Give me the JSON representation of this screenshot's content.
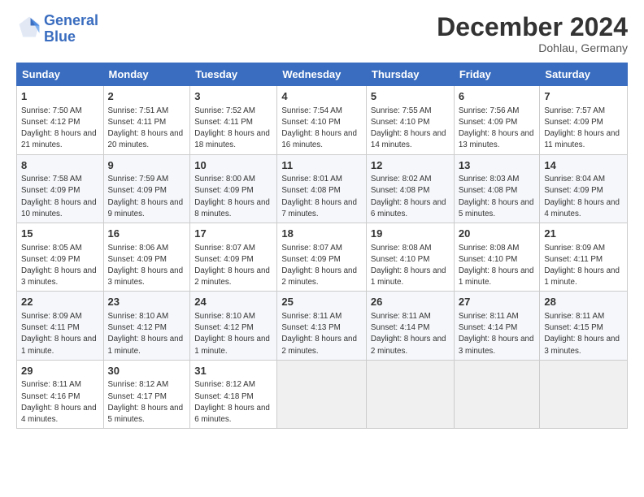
{
  "logo": {
    "line1": "General",
    "line2": "Blue"
  },
  "title": "December 2024",
  "location": "Dohlau, Germany",
  "columns": [
    "Sunday",
    "Monday",
    "Tuesday",
    "Wednesday",
    "Thursday",
    "Friday",
    "Saturday"
  ],
  "weeks": [
    [
      {
        "day": "1",
        "sunrise": "7:50 AM",
        "sunset": "4:12 PM",
        "daylight": "8 hours and 21 minutes."
      },
      {
        "day": "2",
        "sunrise": "7:51 AM",
        "sunset": "4:11 PM",
        "daylight": "8 hours and 20 minutes."
      },
      {
        "day": "3",
        "sunrise": "7:52 AM",
        "sunset": "4:11 PM",
        "daylight": "8 hours and 18 minutes."
      },
      {
        "day": "4",
        "sunrise": "7:54 AM",
        "sunset": "4:10 PM",
        "daylight": "8 hours and 16 minutes."
      },
      {
        "day": "5",
        "sunrise": "7:55 AM",
        "sunset": "4:10 PM",
        "daylight": "8 hours and 14 minutes."
      },
      {
        "day": "6",
        "sunrise": "7:56 AM",
        "sunset": "4:09 PM",
        "daylight": "8 hours and 13 minutes."
      },
      {
        "day": "7",
        "sunrise": "7:57 AM",
        "sunset": "4:09 PM",
        "daylight": "8 hours and 11 minutes."
      }
    ],
    [
      {
        "day": "8",
        "sunrise": "7:58 AM",
        "sunset": "4:09 PM",
        "daylight": "8 hours and 10 minutes."
      },
      {
        "day": "9",
        "sunrise": "7:59 AM",
        "sunset": "4:09 PM",
        "daylight": "8 hours and 9 minutes."
      },
      {
        "day": "10",
        "sunrise": "8:00 AM",
        "sunset": "4:09 PM",
        "daylight": "8 hours and 8 minutes."
      },
      {
        "day": "11",
        "sunrise": "8:01 AM",
        "sunset": "4:08 PM",
        "daylight": "8 hours and 7 minutes."
      },
      {
        "day": "12",
        "sunrise": "8:02 AM",
        "sunset": "4:08 PM",
        "daylight": "8 hours and 6 minutes."
      },
      {
        "day": "13",
        "sunrise": "8:03 AM",
        "sunset": "4:08 PM",
        "daylight": "8 hours and 5 minutes."
      },
      {
        "day": "14",
        "sunrise": "8:04 AM",
        "sunset": "4:09 PM",
        "daylight": "8 hours and 4 minutes."
      }
    ],
    [
      {
        "day": "15",
        "sunrise": "8:05 AM",
        "sunset": "4:09 PM",
        "daylight": "8 hours and 3 minutes."
      },
      {
        "day": "16",
        "sunrise": "8:06 AM",
        "sunset": "4:09 PM",
        "daylight": "8 hours and 3 minutes."
      },
      {
        "day": "17",
        "sunrise": "8:07 AM",
        "sunset": "4:09 PM",
        "daylight": "8 hours and 2 minutes."
      },
      {
        "day": "18",
        "sunrise": "8:07 AM",
        "sunset": "4:09 PM",
        "daylight": "8 hours and 2 minutes."
      },
      {
        "day": "19",
        "sunrise": "8:08 AM",
        "sunset": "4:10 PM",
        "daylight": "8 hours and 1 minute."
      },
      {
        "day": "20",
        "sunrise": "8:08 AM",
        "sunset": "4:10 PM",
        "daylight": "8 hours and 1 minute."
      },
      {
        "day": "21",
        "sunrise": "8:09 AM",
        "sunset": "4:11 PM",
        "daylight": "8 hours and 1 minute."
      }
    ],
    [
      {
        "day": "22",
        "sunrise": "8:09 AM",
        "sunset": "4:11 PM",
        "daylight": "8 hours and 1 minute."
      },
      {
        "day": "23",
        "sunrise": "8:10 AM",
        "sunset": "4:12 PM",
        "daylight": "8 hours and 1 minute."
      },
      {
        "day": "24",
        "sunrise": "8:10 AM",
        "sunset": "4:12 PM",
        "daylight": "8 hours and 1 minute."
      },
      {
        "day": "25",
        "sunrise": "8:11 AM",
        "sunset": "4:13 PM",
        "daylight": "8 hours and 2 minutes."
      },
      {
        "day": "26",
        "sunrise": "8:11 AM",
        "sunset": "4:14 PM",
        "daylight": "8 hours and 2 minutes."
      },
      {
        "day": "27",
        "sunrise": "8:11 AM",
        "sunset": "4:14 PM",
        "daylight": "8 hours and 3 minutes."
      },
      {
        "day": "28",
        "sunrise": "8:11 AM",
        "sunset": "4:15 PM",
        "daylight": "8 hours and 3 minutes."
      }
    ],
    [
      {
        "day": "29",
        "sunrise": "8:11 AM",
        "sunset": "4:16 PM",
        "daylight": "8 hours and 4 minutes."
      },
      {
        "day": "30",
        "sunrise": "8:12 AM",
        "sunset": "4:17 PM",
        "daylight": "8 hours and 5 minutes."
      },
      {
        "day": "31",
        "sunrise": "8:12 AM",
        "sunset": "4:18 PM",
        "daylight": "8 hours and 6 minutes."
      },
      null,
      null,
      null,
      null
    ]
  ],
  "labels": {
    "sunrise": "Sunrise:",
    "sunset": "Sunset:",
    "daylight": "Daylight:"
  }
}
